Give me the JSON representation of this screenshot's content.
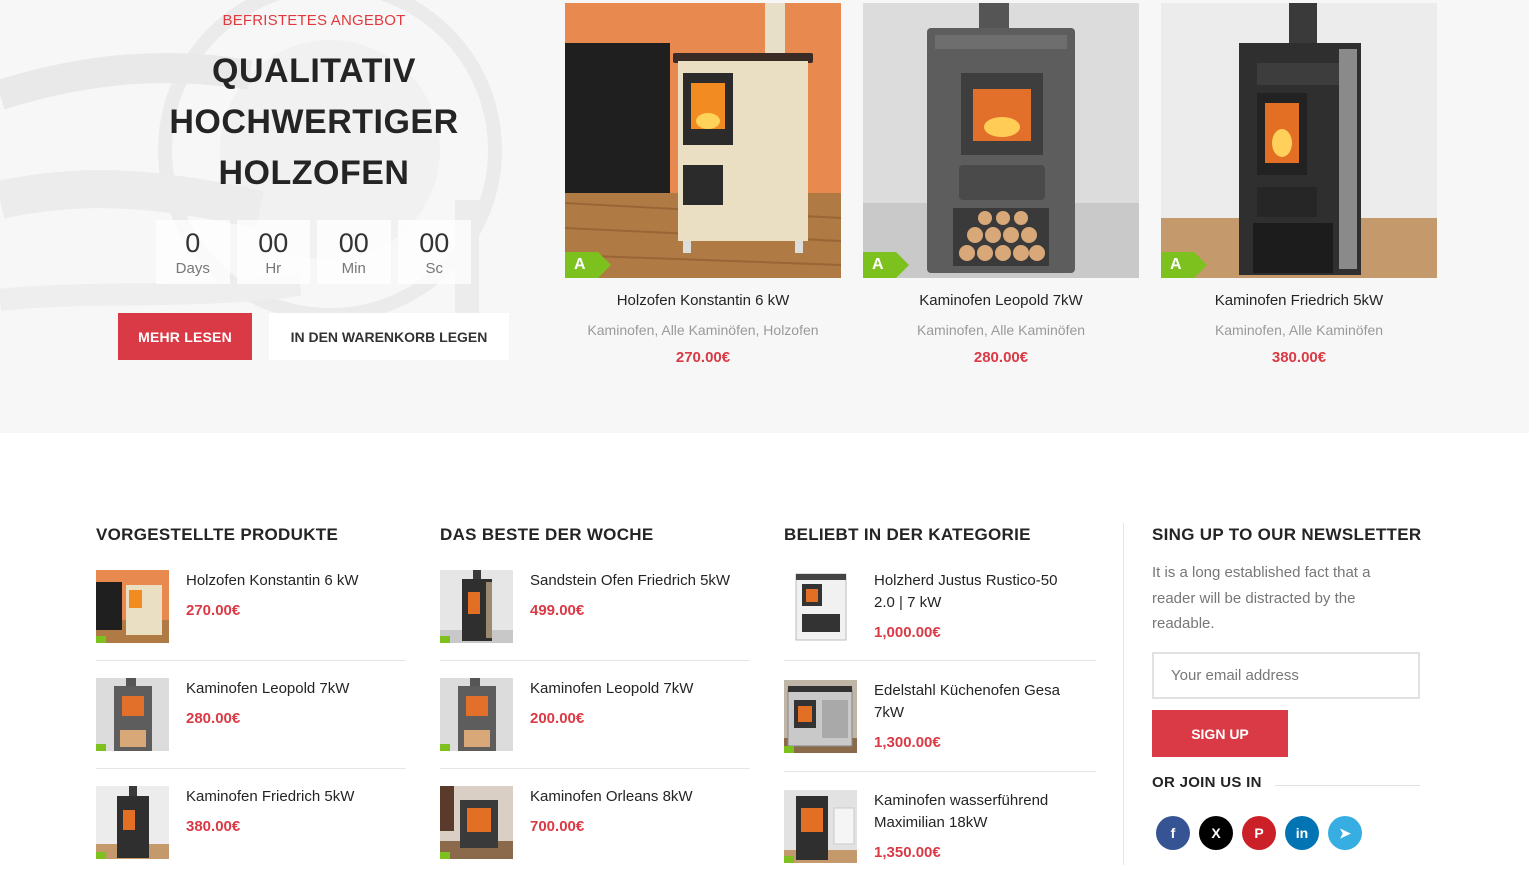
{
  "hero": {
    "kicker": "BEFRISTETES ANGEBOT",
    "title_lines": [
      "QUALITATIV",
      "HOCHWERTIGER",
      "HOLZOFEN"
    ],
    "countdown": [
      {
        "value": "0",
        "label": "Days"
      },
      {
        "value": "00",
        "label": "Hr"
      },
      {
        "value": "00",
        "label": "Min"
      },
      {
        "value": "00",
        "label": "Sc"
      }
    ],
    "read_more": "MEHR LESEN",
    "add_to_cart": "IN DEN WARENKORB LEGEN"
  },
  "products": [
    {
      "name": "Holzofen Konstantin 6 kW",
      "categories": "Kaminofen, Alle Kaminöfen, Holzofen",
      "price": "270.00€",
      "badge": "A"
    },
    {
      "name": "Kaminofen Leopold 7kW",
      "categories": "Kaminofen, Alle Kaminöfen",
      "price": "280.00€",
      "badge": "A"
    },
    {
      "name": "Kaminofen Friedrich 5kW",
      "categories": "Kaminofen, Alle Kaminöfen",
      "price": "380.00€",
      "badge": "A"
    }
  ],
  "columns": [
    {
      "title": "VORGESTELLTE PRODUKTE",
      "items": [
        {
          "name": "Holzofen Konstantin 6 kW",
          "price": "270.00€"
        },
        {
          "name": "Kaminofen Leopold 7kW",
          "price": "280.00€"
        },
        {
          "name": "Kaminofen Friedrich 5kW",
          "price": "380.00€"
        }
      ]
    },
    {
      "title": "DAS BESTE DER WOCHE",
      "items": [
        {
          "name": "Sandstein Ofen Friedrich 5kW",
          "price": "499.00€"
        },
        {
          "name": "Kaminofen Leopold 7kW",
          "price": "200.00€"
        },
        {
          "name": "Kaminofen Orleans 8kW",
          "price": "700.00€"
        }
      ]
    },
    {
      "title": "BELIEBT IN DER KATEGORIE",
      "items": [
        {
          "name_lines": [
            "Holzherd Justus Rustico-50",
            "2.0 | 7 kW"
          ],
          "price": "1,000.00€"
        },
        {
          "name_lines": [
            "Edelstahl Küchenofen Gesa",
            "7kW"
          ],
          "price": "1,300.00€"
        },
        {
          "name_lines": [
            "Kaminofen wasserführend",
            "Maximilian 18kW"
          ],
          "price": "1,350.00€"
        }
      ]
    }
  ],
  "newsletter": {
    "title": "SING UP TO OUR NEWSLETTER",
    "text": "It is a long established fact that a reader will be distracted by the readable.",
    "placeholder": "Your email address",
    "button": "SIGN UP",
    "join_title": "OR JOIN US IN",
    "socials": [
      {
        "name": "facebook",
        "glyph": "f",
        "color": "#365493"
      },
      {
        "name": "x",
        "glyph": "X",
        "color": "#000000"
      },
      {
        "name": "pinterest",
        "glyph": "P",
        "color": "#cb2027"
      },
      {
        "name": "linkedin",
        "glyph": "in",
        "color": "#0274b3"
      },
      {
        "name": "telegram",
        "glyph": "➤",
        "color": "#37aee2"
      }
    ]
  },
  "colors": {
    "accent": "#d93a45",
    "badge": "#7cc11d"
  }
}
